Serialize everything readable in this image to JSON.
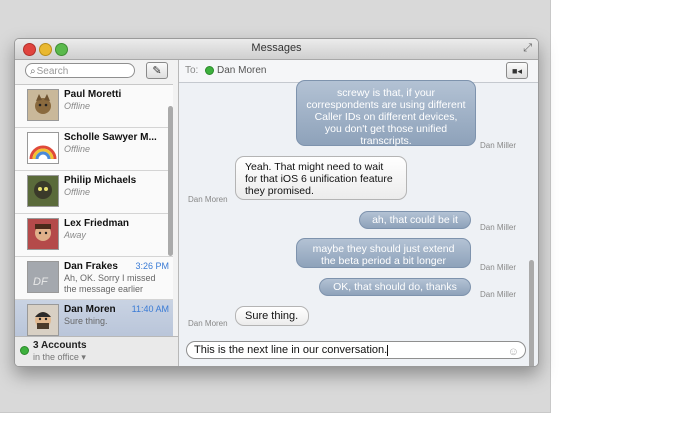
{
  "window": {
    "title": "Messages"
  },
  "sidebar": {
    "search_placeholder": "Search",
    "conversations": [
      {
        "name": "Paul Moretti",
        "status": "Offline",
        "time": ""
      },
      {
        "name": "Scholle Sawyer M...",
        "status": "Offline",
        "time": ""
      },
      {
        "name": "Philip Michaels",
        "status": "Offline",
        "time": ""
      },
      {
        "name": "Lex Friedman",
        "status": "Away",
        "time": ""
      },
      {
        "name": "Dan Frakes",
        "status": "Ah, OK. Sorry I missed the message earlier",
        "time": "3:26 PM",
        "initials": "DF"
      },
      {
        "name": "Dan Moren",
        "status": "Sure thing.",
        "time": "11:40 AM"
      }
    ],
    "accounts": {
      "title": "3 Accounts",
      "subtitle": "in the office"
    }
  },
  "chat": {
    "to_label": "To:",
    "recipient": "Dan Moren",
    "messages": [
      {
        "direction": "out",
        "sender": "Dan Miller",
        "text": "screwy is that, if your correspondents are using different Caller IDs on different devices, you don't get those unified transcripts."
      },
      {
        "direction": "in",
        "sender": "Dan Moren",
        "text": "Yeah. That might need to wait for that iOS 6 unification feature they promised."
      },
      {
        "direction": "out",
        "sender": "Dan Miller",
        "text": "ah, that could be it"
      },
      {
        "direction": "out",
        "sender": "Dan Miller",
        "text": "maybe they should just extend the beta period a bit longer"
      },
      {
        "direction": "out",
        "sender": "Dan Miller",
        "text": "OK, that should do, thanks"
      },
      {
        "direction": "in",
        "sender": "Dan Moren",
        "text": "Sure thing."
      }
    ],
    "input_value": "This is the next line in our conversation."
  },
  "colors": {
    "online": "#3db03d",
    "outgoing_bubble": "#9aacc4",
    "time_accent": "#3a7bd5"
  },
  "icons": [
    "search-icon",
    "compose-icon",
    "video-icon",
    "emoji-icon",
    "fullscreen-icon"
  ]
}
